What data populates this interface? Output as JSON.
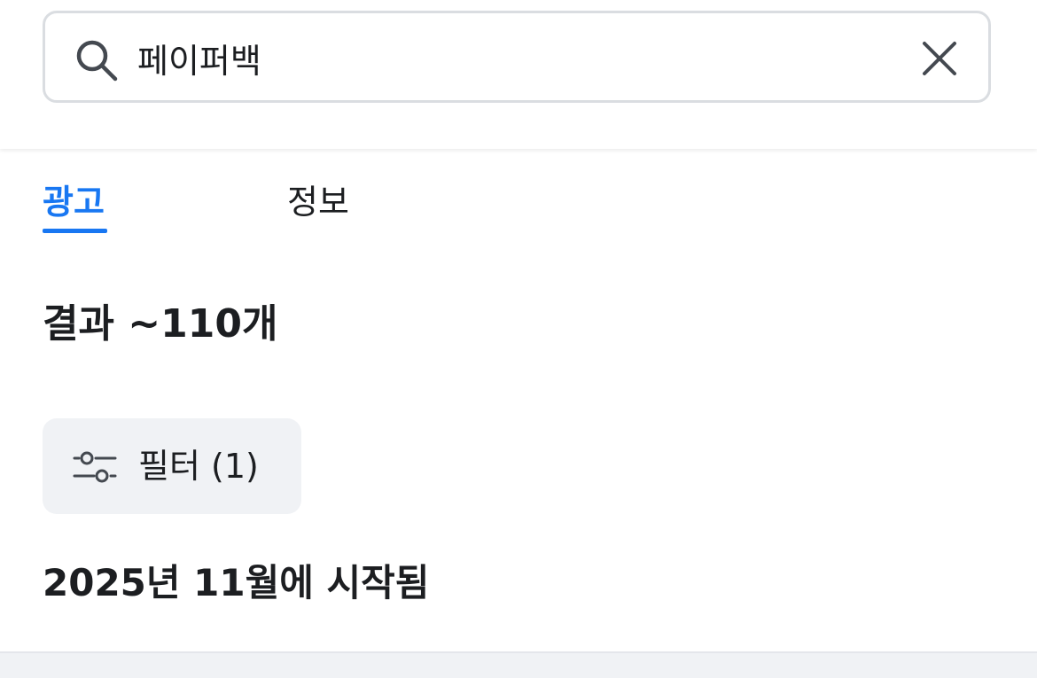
{
  "search": {
    "value": "페이퍼백",
    "placeholder": ""
  },
  "tabs": [
    {
      "label": "광고",
      "active": true
    },
    {
      "label": "정보",
      "active": false
    }
  ],
  "results": {
    "count_label": "결과 ~110개"
  },
  "filter": {
    "label": "필터 (1)"
  },
  "section": {
    "heading": "2025년 11월에 시작됨"
  },
  "icons": {
    "search": "search-icon",
    "clear": "close-icon",
    "filter": "filter-sliders-icon"
  },
  "colors": {
    "accent": "#1877f2",
    "text": "#1c1e21",
    "filter_bg": "#f0f2f5",
    "border": "#dadde1"
  }
}
